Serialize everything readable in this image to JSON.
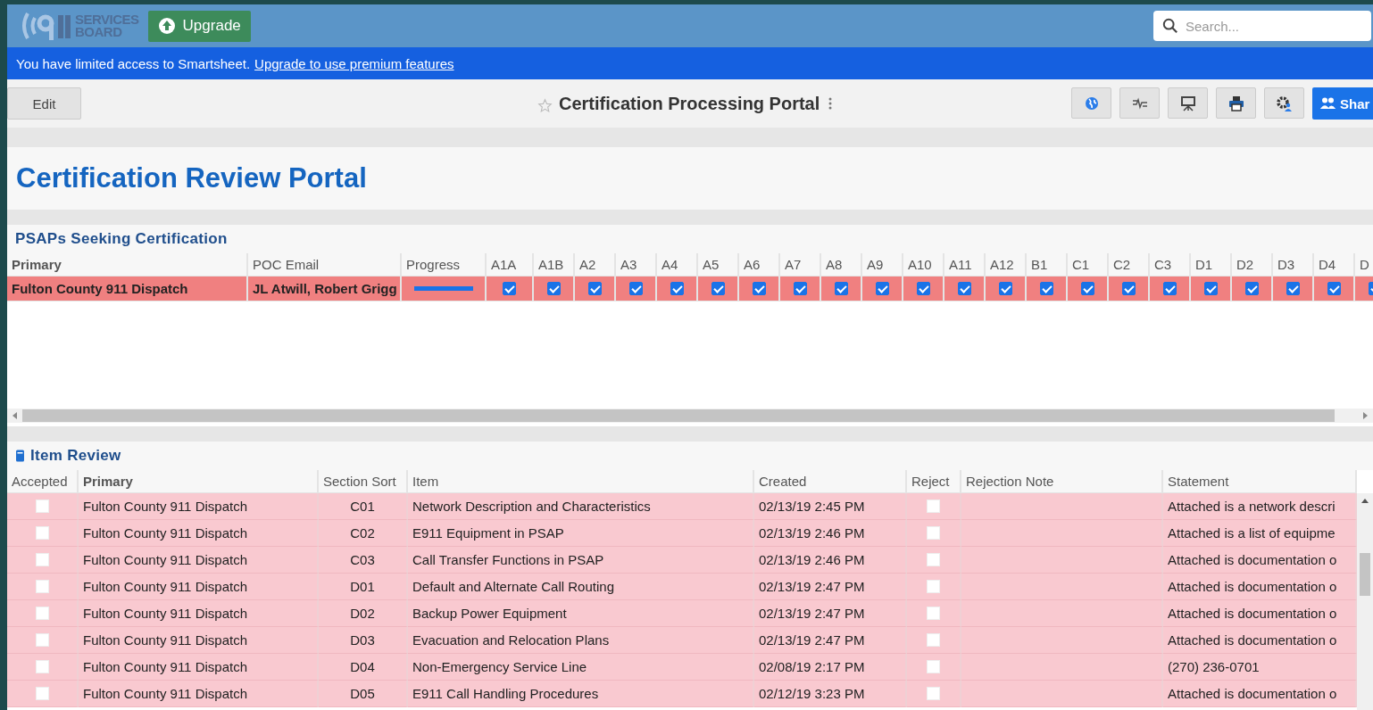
{
  "header": {
    "logo_text": [
      "SERVICES",
      "BOARD"
    ],
    "upgrade_button": "Upgrade",
    "search": {
      "placeholder": "Search..."
    }
  },
  "banner": {
    "text": "You have limited access to Smartsheet.",
    "link": "Upgrade to use premium features"
  },
  "toolbar": {
    "edit_button": "Edit",
    "title": "Certification Processing Portal",
    "favorite": false,
    "share_button": "Shar"
  },
  "page_title": "Certification Review Portal",
  "psaps": {
    "title": "PSAPs Seeking Certification",
    "columns": [
      "Primary",
      "POC Email",
      "Progress",
      "A1A",
      "A1B",
      "A2",
      "A3",
      "A4",
      "A5",
      "A6",
      "A7",
      "A8",
      "A9",
      "A10",
      "A11",
      "A12",
      "B1",
      "C1",
      "C2",
      "C3",
      "D1",
      "D2",
      "D3",
      "D4",
      "D"
    ],
    "rows": [
      {
        "primary": "Fulton County 911 Dispatch",
        "poc_email": "JL Atwill, Robert Grigg",
        "progress": {
          "level": 1
        },
        "checks": [
          {
            "checked": true
          },
          {
            "checked": true
          },
          {
            "checked": true
          },
          {
            "checked": true
          },
          {
            "checked": true
          },
          {
            "checked": true
          },
          {
            "checked": true
          },
          {
            "checked": true
          },
          {
            "checked": true
          },
          {
            "checked": true
          },
          {
            "checked": true
          },
          {
            "checked": true
          },
          {
            "checked": true
          },
          {
            "checked": true
          },
          {
            "checked": true
          },
          {
            "checked": true
          },
          {
            "checked": true
          },
          {
            "checked": true
          },
          {
            "checked": true
          },
          {
            "checked": true
          },
          {
            "checked": true
          },
          {
            "checked": true
          }
        ]
      }
    ]
  },
  "item_review": {
    "title": "Item Review",
    "columns": [
      "Accepted",
      "Primary",
      "Section Sort",
      "Item",
      "Created",
      "Reject",
      "Rejection Note",
      "Statement"
    ],
    "rows": [
      {
        "accepted": false,
        "primary": "Fulton County 911 Dispatch",
        "section": "C01",
        "item": "Network Description and Characteristics",
        "created": "02/13/19 2:45 PM",
        "reject": false,
        "statement": "Attached is a network descri"
      },
      {
        "accepted": false,
        "primary": "Fulton County 911 Dispatch",
        "section": "C02",
        "item": "E911 Equipment in PSAP",
        "created": "02/13/19 2:46 PM",
        "reject": false,
        "statement": "Attached is a list of equipme"
      },
      {
        "accepted": false,
        "primary": "Fulton County 911 Dispatch",
        "section": "C03",
        "item": "Call Transfer Functions in PSAP",
        "created": "02/13/19 2:46 PM",
        "reject": false,
        "statement": "Attached is documentation o"
      },
      {
        "accepted": false,
        "primary": "Fulton County 911 Dispatch",
        "section": "D01",
        "item": "Default and Alternate Call Routing",
        "created": "02/13/19 2:47 PM",
        "reject": false,
        "statement": "Attached is documentation o"
      },
      {
        "accepted": false,
        "primary": "Fulton County 911 Dispatch",
        "section": "D02",
        "item": "Backup Power Equipment",
        "created": "02/13/19 2:47 PM",
        "reject": false,
        "statement": "Attached is documentation o"
      },
      {
        "accepted": false,
        "primary": "Fulton County 911 Dispatch",
        "section": "D03",
        "item": "Evacuation and Relocation Plans",
        "created": "02/13/19 2:47 PM",
        "reject": false,
        "statement": "Attached is documentation o"
      },
      {
        "accepted": false,
        "primary": "Fulton County 911 Dispatch",
        "section": "D04",
        "item": "Non-Emergency Service Line",
        "created": "02/08/19 2:17 PM",
        "reject": false,
        "statement": "(270) 236-0701"
      },
      {
        "accepted": false,
        "primary": "Fulton County 911 Dispatch",
        "section": "D05",
        "item": "E911 Call Handling Procedures",
        "created": "02/12/19 3:23 PM",
        "reject": false,
        "statement": "Attached is documentation o"
      }
    ]
  }
}
